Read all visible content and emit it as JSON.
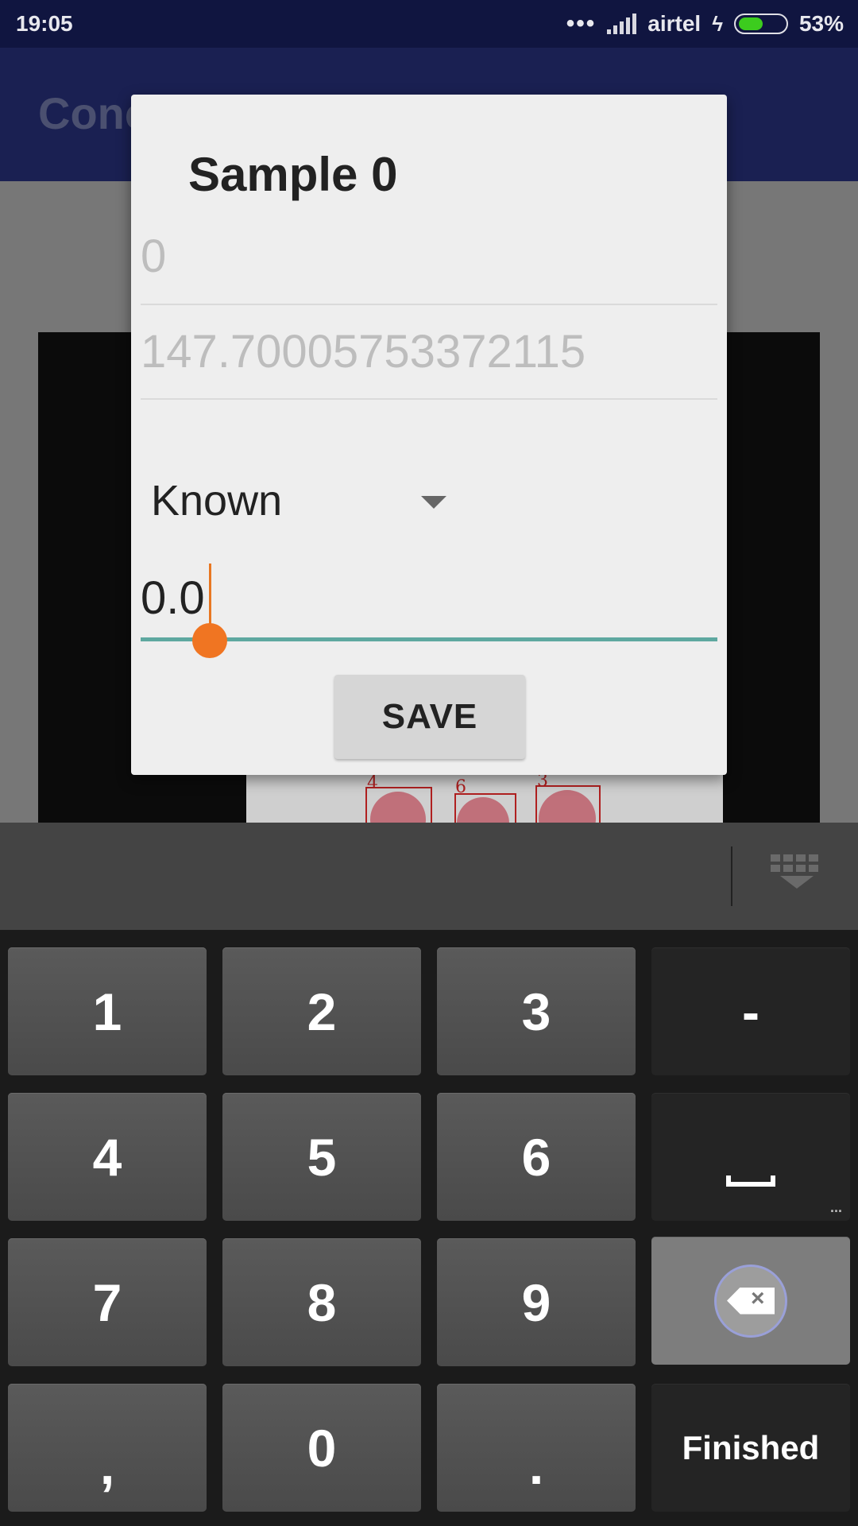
{
  "status_bar": {
    "time": "19:05",
    "carrier": "airtel",
    "battery_percent": "53%",
    "battery_level": 0.53
  },
  "app_bar": {
    "title_partial": "Conc"
  },
  "photo_labels": [
    "4",
    "6",
    "3"
  ],
  "dialog": {
    "title": "Sample 0",
    "field_index_value": "0",
    "field_measure_value": "147.70005753372115",
    "spinner_selected": "Known",
    "concentration_value": "0.0",
    "save_label": "SAVE"
  },
  "keyboard": {
    "keys": [
      "1",
      "2",
      "3",
      "-",
      "4",
      "5",
      "6",
      "7",
      "8",
      "9",
      ",",
      "0",
      ".",
      "Finished"
    ],
    "space_more": "..."
  },
  "colors": {
    "accent": "#f07522",
    "underline": "#5ea8a0",
    "status_bar": "#101540",
    "app_bar": "#1a2052"
  }
}
